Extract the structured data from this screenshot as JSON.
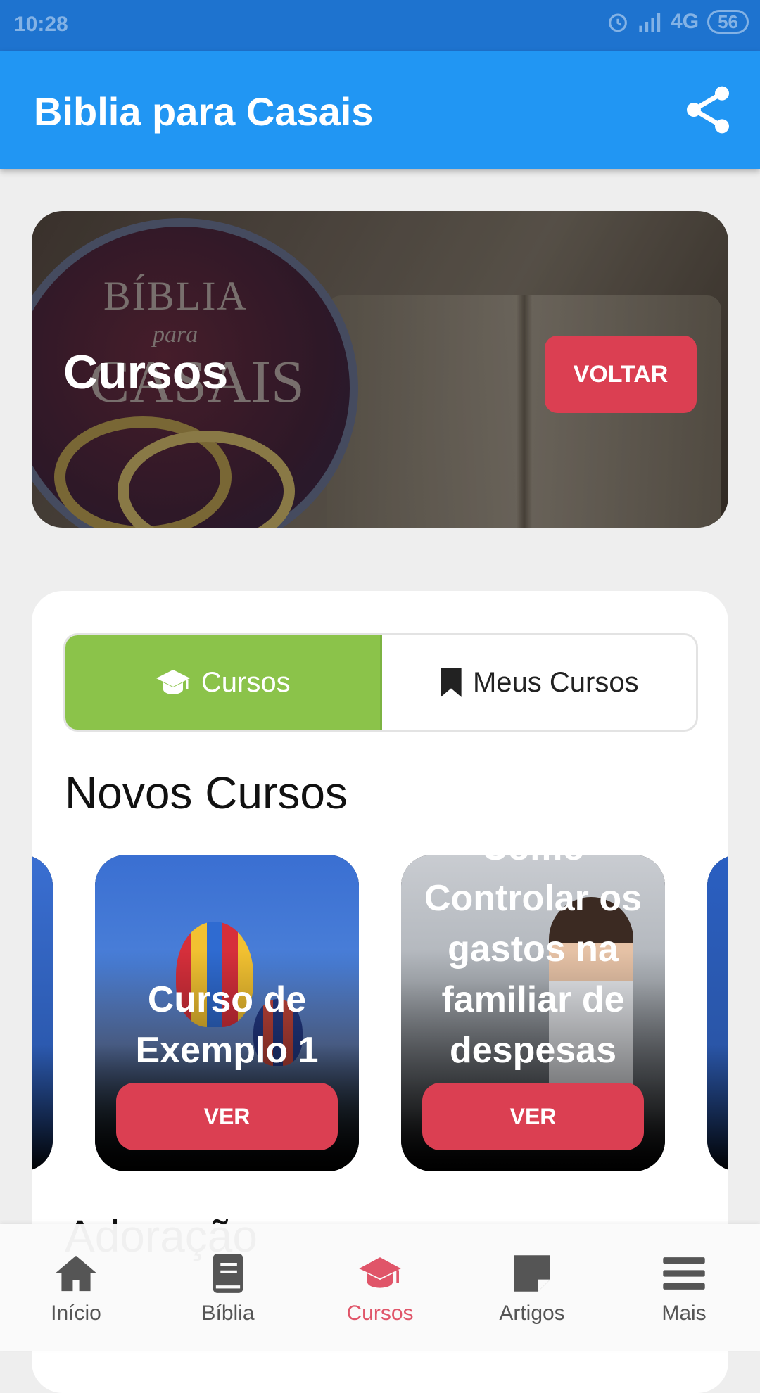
{
  "status_bar": {
    "time": "10:28",
    "network": "4G",
    "battery": "56"
  },
  "app_bar": {
    "title": "Biblia para Casais",
    "share_icon": "share-icon"
  },
  "hero": {
    "title": "Cursos",
    "back_button": "VOLTAR",
    "logo_text_1": "BÍBLIA",
    "logo_text_2": "para",
    "logo_text_3": "CASAIS"
  },
  "tabs": [
    {
      "label": "Cursos",
      "icon": "graduation-cap-icon",
      "active": true
    },
    {
      "label": "Meus Cursos",
      "icon": "bookmark-icon",
      "active": false
    }
  ],
  "sections": {
    "new_courses": "Novos Cursos",
    "next_section": "Adoração"
  },
  "courses": [
    {
      "title": "Curso de Exemplo 1",
      "button": "VER"
    },
    {
      "title": "Como Controlar os gastos na familiar de despesas",
      "button": "VER"
    }
  ],
  "bottom_nav": [
    {
      "label": "Início",
      "icon": "home-icon"
    },
    {
      "label": "Bíblia",
      "icon": "book-icon"
    },
    {
      "label": "Cursos",
      "icon": "graduation-cap-icon",
      "active": true
    },
    {
      "label": "Artigos",
      "icon": "note-icon"
    },
    {
      "label": "Mais",
      "icon": "menu-icon"
    }
  ],
  "colors": {
    "status_bar": "#1e73cf",
    "app_bar": "#2196f3",
    "accent_red": "#db3f52",
    "tab_active": "#8bc34a",
    "nav_active": "#e05569"
  }
}
